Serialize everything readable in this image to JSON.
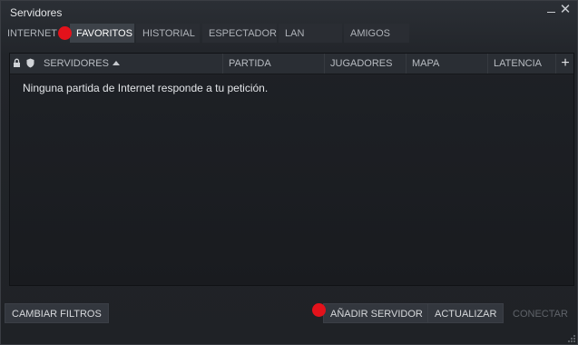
{
  "window": {
    "title": "Servidores"
  },
  "tabs": [
    {
      "label": "INTERNET"
    },
    {
      "label": "FAVORITOS"
    },
    {
      "label": "HISTORIAL"
    },
    {
      "label": "ESPECTADOR"
    },
    {
      "label": "LAN"
    },
    {
      "label": "AMIGOS"
    }
  ],
  "columns": {
    "servers": "SERVIDORES",
    "game": "PARTIDA",
    "players": "JUGADORES",
    "map": "MAPA",
    "latency": "LATENCIA"
  },
  "list": {
    "empty_message": "Ninguna partida de Internet responde a tu petición."
  },
  "buttons": {
    "change_filters": "CAMBIAR FILTROS",
    "add_server": "AÑADIR SERVIDOR",
    "refresh": "ACTUALIZAR",
    "connect": "CONECTAR"
  },
  "icons": {
    "lock": "lock-icon",
    "secure": "shield-icon",
    "sort": "sort-ascending-icon",
    "add_column": "plus-icon",
    "minimize": "minimize-icon",
    "close": "close-icon"
  },
  "colors": {
    "marker": "#e3121b",
    "active_tab": "#3d4249"
  }
}
